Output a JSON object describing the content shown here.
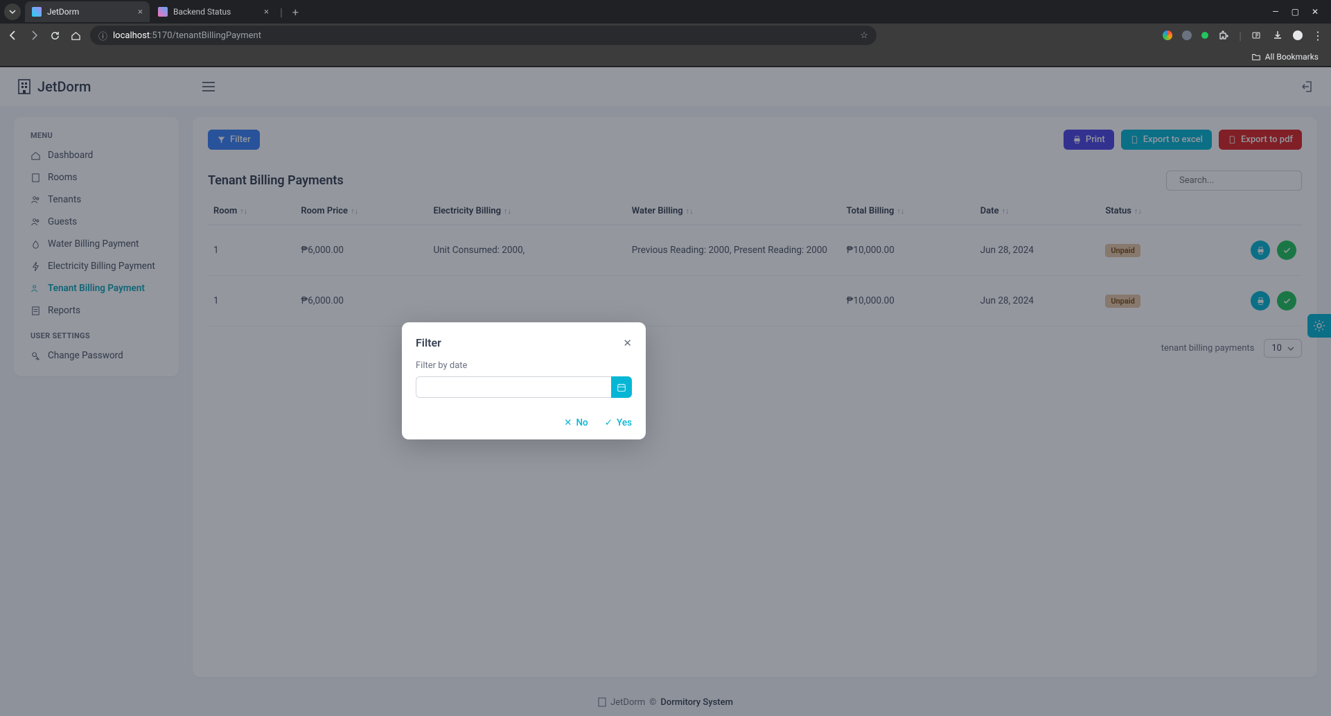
{
  "browser": {
    "tabs": [
      {
        "title": "JetDorm",
        "active": true
      },
      {
        "title": "Backend Status",
        "active": false
      }
    ],
    "url_host": "localhost",
    "url_port": ":5170",
    "url_path": "/tenantBillingPayment",
    "all_bookmarks": "All Bookmarks"
  },
  "app": {
    "brand": "JetDorm",
    "sidebar": {
      "menu_label": "MENU",
      "items": [
        {
          "label": "Dashboard"
        },
        {
          "label": "Rooms"
        },
        {
          "label": "Tenants"
        },
        {
          "label": "Guests"
        },
        {
          "label": "Water Billing Payment"
        },
        {
          "label": "Electricity Billing Payment"
        },
        {
          "label": "Tenant Billing Payment"
        },
        {
          "label": "Reports"
        }
      ],
      "settings_label": "USER SETTINGS",
      "settings_items": [
        {
          "label": "Change Password"
        }
      ]
    },
    "toolbar": {
      "filter": "Filter",
      "print": "Print",
      "export_excel": "Export to excel",
      "export_pdf": "Export to pdf"
    },
    "section_title": "Tenant Billing Payments",
    "search_placeholder": "Search...",
    "columns": {
      "room": "Room",
      "room_price": "Room Price",
      "electricity": "Electricity Billing",
      "water": "Water Billing",
      "total": "Total Billing",
      "date": "Date",
      "status": "Status"
    },
    "rows": [
      {
        "room": "1",
        "room_price": "₱6,000.00",
        "electricity": "Unit Consumed: 2000,",
        "water": "Previous Reading: 2000, Present Reading: 2000",
        "total": "₱10,000.00",
        "date": "Jun 28, 2024",
        "status": "Unpaid"
      },
      {
        "room": "1",
        "room_price": "₱6,000.00",
        "electricity": "",
        "water": "",
        "total": "₱10,000.00",
        "date": "Jun 28, 2024",
        "status": "Unpaid"
      }
    ],
    "pager_text": "tenant billing payments",
    "page_size": "10",
    "footer_brand": "JetDorm",
    "footer_copy": "©",
    "footer_link": "Dormitory System"
  },
  "modal": {
    "title": "Filter",
    "label": "Filter by date",
    "no": "No",
    "yes": "Yes"
  }
}
